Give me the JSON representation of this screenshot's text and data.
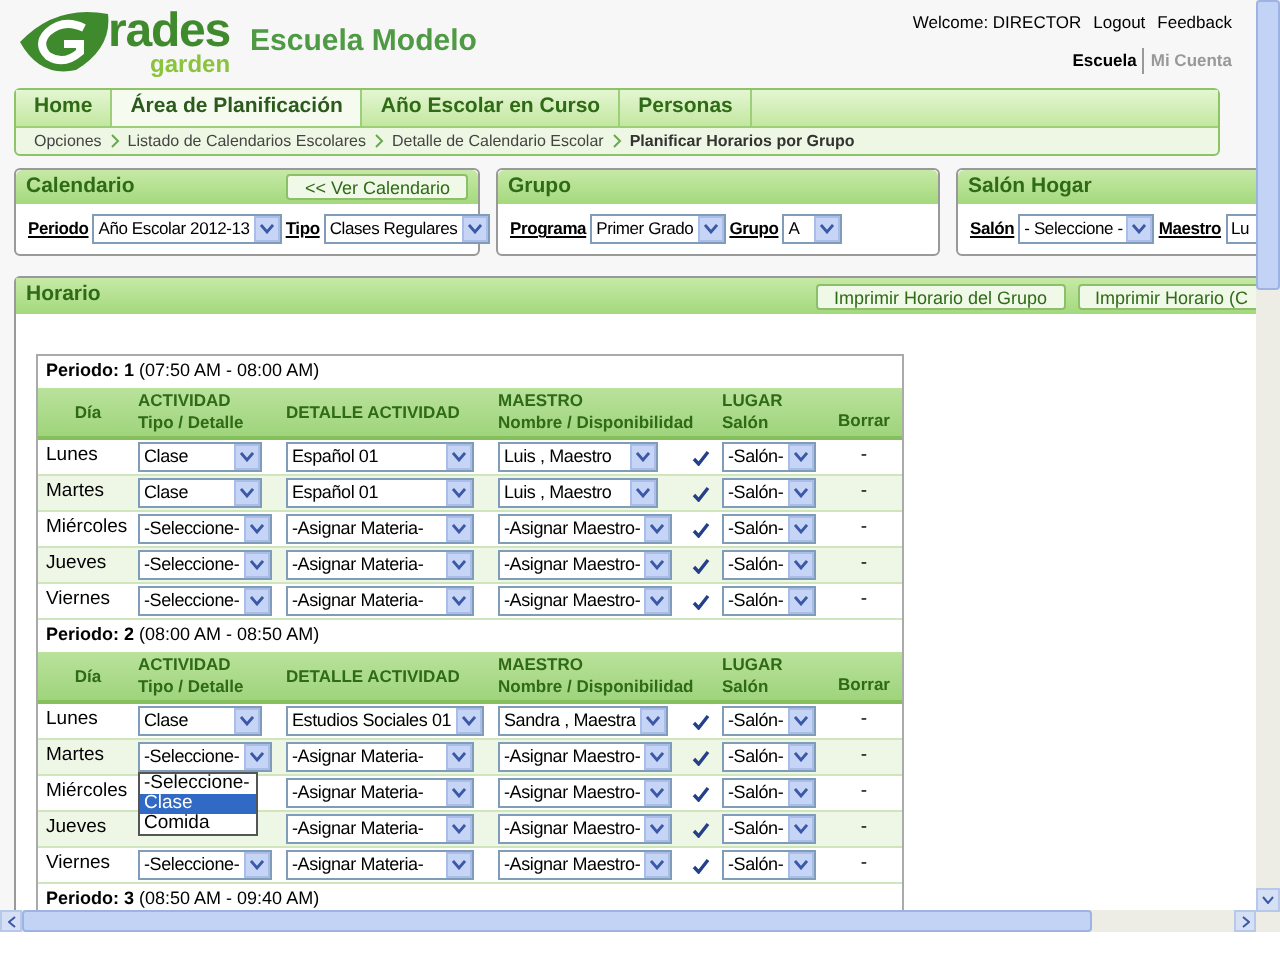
{
  "header": {
    "logo": {
      "text": "rades",
      "subtext": "garden"
    },
    "school_name": "Escuela Modelo",
    "welcome": "Welcome: DIRECTOR",
    "links": [
      "Logout",
      "Feedback"
    ],
    "account_links": [
      {
        "label": "Escuela",
        "selected": true
      },
      {
        "label": "Mi Cuenta",
        "selected": false
      }
    ]
  },
  "tabs": [
    {
      "label": "Home",
      "selected": false
    },
    {
      "label": "Área de Planificación",
      "selected": true
    },
    {
      "label": "Año Escolar en Curso",
      "selected": false
    },
    {
      "label": "Personas",
      "selected": false
    }
  ],
  "breadcrumb": [
    "Opciones",
    "Listado de Calendarios Escolares",
    "Detalle de Calendario Escolar",
    "Planificar Horarios por Grupo"
  ],
  "panels": [
    {
      "title": "Calendario",
      "button": "<< Ver Calendario",
      "fields": [
        {
          "label": "Periodo",
          "value": "Año Escolar 2012-13"
        },
        {
          "label": "Tipo",
          "value": "Clases Regulares"
        }
      ]
    },
    {
      "title": "Grupo",
      "fields": [
        {
          "label": "Programa",
          "value": "Primer Grado"
        },
        {
          "label": "Grupo",
          "value": "A"
        }
      ]
    },
    {
      "title": "Salón Hogar",
      "fields": [
        {
          "label": "Salón",
          "value": "- Seleccione -"
        },
        {
          "label": "Maestro",
          "value": "Lu"
        }
      ]
    }
  ],
  "horario": {
    "title": "Horario",
    "buttons": [
      "Imprimir Horario del Grupo",
      "Imprimir Horario (C"
    ],
    "periods": [
      {
        "label": "**Periodo: 1** (07:50 AM - 08:00 AM)",
        "columns": [
          {
            "title": "Día"
          },
          {
            "title": "ACTIVIDAD",
            "subtitle": "Tipo / Detalle"
          },
          {
            "title": "DETALLE ACTIVIDAD"
          },
          {
            "title": "MAESTRO",
            "subtitle": "Nombre / Disponibilidad"
          },
          {
            "title": "LUGAR",
            "subtitle": "Salón"
          },
          {
            "title": "Borrar"
          }
        ],
        "rows": [
          {
            "day": "Lunes",
            "actividad": "Clase",
            "detalle": "Español 01",
            "maestro": "Luis , Maestro",
            "lugar": "-Salón-",
            "borrar": "-"
          },
          {
            "day": "Martes",
            "actividad": "Clase",
            "detalle": "Español 01",
            "maestro": "Luis , Maestro",
            "lugar": "-Salón-",
            "borrar": "-"
          },
          {
            "day": "Miércoles",
            "actividad": "-Seleccione-",
            "detalle": "-Asignar Materia-",
            "maestro": "-Asignar Maestro-",
            "lugar": "-Salón-",
            "borrar": "-"
          },
          {
            "day": "Jueves",
            "actividad": "-Seleccione-",
            "detalle": "-Asignar Materia-",
            "maestro": "-Asignar Maestro-",
            "lugar": "-Salón-",
            "borrar": "-"
          },
          {
            "day": "Viernes",
            "actividad": "-Seleccione-",
            "detalle": "-Asignar Materia-",
            "maestro": "-Asignar Maestro-",
            "lugar": "-Salón-",
            "borrar": "-"
          }
        ]
      },
      {
        "label": "**Periodo: 2** (08:00 AM - 08:50 AM)",
        "columns": [
          {
            "title": "Día"
          },
          {
            "title": "ACTIVIDAD",
            "subtitle": "Tipo / Detalle"
          },
          {
            "title": "DETALLE ACTIVIDAD"
          },
          {
            "title": "MAESTRO",
            "subtitle": "Nombre / Disponibilidad"
          },
          {
            "title": "LUGAR",
            "subtitle": "Salón"
          },
          {
            "title": "Borrar"
          }
        ],
        "rows": [
          {
            "day": "Lunes",
            "actividad": "Clase",
            "detalle": "Estudios Sociales 01",
            "maestro": "Sandra , Maestra",
            "lugar": "-Salón-",
            "borrar": "-"
          },
          {
            "day": "Martes",
            "actividad": "-Seleccione-",
            "actividad_options": [
              {
                "label": "-Seleccione-",
                "selected": false
              },
              {
                "label": "Clase",
                "selected": true
              },
              {
                "label": "Comida",
                "selected": false
              }
            ],
            "detalle": "-Asignar Materia-",
            "maestro": "-Asignar Maestro-",
            "lugar": "-Salón-",
            "borrar": "-"
          },
          {
            "day": "Miércoles",
            "detalle": "-Asignar Materia-",
            "maestro": "-Asignar Maestro-",
            "lugar": "-Salón-",
            "borrar": "-"
          },
          {
            "day": "Jueves",
            "detalle": "-Asignar Materia-",
            "maestro": "-Asignar Maestro-",
            "lugar": "-Salón-",
            "borrar": "-"
          },
          {
            "day": "Viernes",
            "actividad": "-Seleccione-",
            "detalle": "-Asignar Materia-",
            "maestro": "-Asignar Maestro-",
            "lugar": "-Salón-",
            "borrar": "-"
          }
        ]
      },
      {
        "label": "**Periodo: 3** (08:50 AM - 09:40 AM)"
      }
    ]
  }
}
